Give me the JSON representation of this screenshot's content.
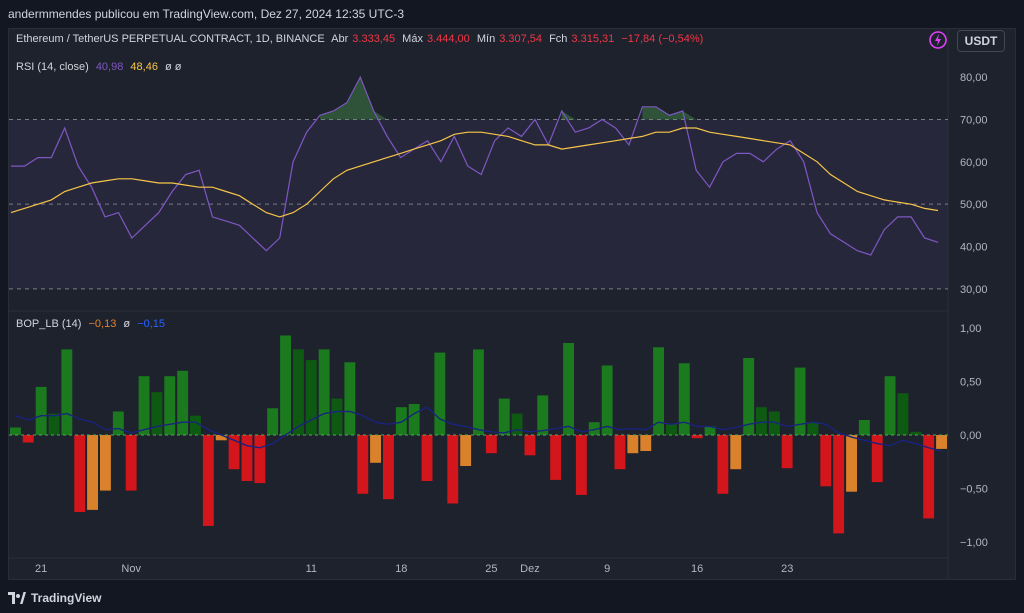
{
  "header": {
    "publisher_line": "andermmendes publicou em TradingView.com, Dez 27, 2024 12:35 UTC-3"
  },
  "symbol_legend": {
    "symbol": "Ethereum / TetherUS PERPETUAL CONTRACT, 1D, BINANCE",
    "open_label": "Abr",
    "open_value": "3.333,45",
    "high_label": "Máx",
    "high_value": "3.444,00",
    "low_label": "Mín",
    "low_value": "3.307,54",
    "close_label": "Fch",
    "close_value": "3.315,31",
    "change_value": "−17,84 (−0,54%)"
  },
  "rsi_legend": {
    "name": "RSI (14, close)",
    "rsi_value": "40,98",
    "ma_value": "48,46",
    "extra": "ø  ø"
  },
  "bop_legend": {
    "name": "BOP_LB (14)",
    "bop_value": "−0,13",
    "extra": "ø",
    "signal_value": "−0,15"
  },
  "currency_button": "USDT",
  "footer": {
    "brand": "TradingView"
  },
  "colors": {
    "background": "#131722",
    "pane": "#1e222d",
    "rsi_line": "#7e57c2",
    "rsi_ma": "#f7c548",
    "bop_green_strong": "#1b7a1e",
    "bop_green_weak": "#0f5a12",
    "bop_red_strong": "#d3151c",
    "bop_orange": "#d9822b",
    "bop_signal": "#1a237e"
  },
  "x_axis": {
    "labels": [
      "21",
      "Nov",
      "11",
      "18",
      "25",
      "Dez",
      "9",
      "16",
      "23"
    ],
    "label_bar_index": [
      2,
      9,
      23,
      30,
      37,
      40,
      46,
      53,
      60
    ]
  },
  "chart_data": [
    {
      "type": "line",
      "name": "RSI",
      "ylim": [
        25,
        85
      ],
      "yticks": [
        "80,00",
        "70,00",
        "60,00",
        "50,00",
        "40,00",
        "30,00"
      ],
      "ytick_values": [
        80,
        70,
        60,
        50,
        40,
        30
      ],
      "bands": {
        "upper": 70,
        "middle": 50,
        "lower": 30
      },
      "series": [
        {
          "name": "RSI (14, close)",
          "values": [
            59,
            59,
            61,
            61,
            68,
            59,
            54,
            47,
            48,
            42,
            45,
            48,
            53,
            57,
            58,
            47,
            46,
            45,
            42,
            39,
            42,
            60,
            67,
            71,
            72,
            74,
            80,
            72,
            66,
            61,
            63,
            65,
            60,
            66,
            59,
            57,
            65,
            68,
            66,
            70,
            64,
            72,
            67,
            68,
            70,
            68,
            64,
            73,
            73,
            71,
            72,
            58,
            54,
            60,
            62,
            62,
            60,
            63,
            65,
            60,
            48,
            43,
            41,
            39,
            38,
            44,
            47,
            47,
            42,
            41
          ]
        },
        {
          "name": "RSI MA",
          "values": [
            48,
            49,
            50,
            51,
            53,
            54,
            55,
            55.5,
            56,
            56,
            55.5,
            55,
            55,
            54.5,
            54,
            54,
            53,
            52,
            50,
            48,
            47,
            48,
            50,
            53,
            56,
            58,
            59,
            60,
            61,
            62,
            63,
            64,
            65,
            66.5,
            67,
            67,
            66.5,
            66,
            65,
            64,
            64,
            63,
            63.5,
            64,
            64.5,
            65,
            65.5,
            66,
            67,
            67,
            68,
            68,
            67,
            66.5,
            66,
            65.5,
            65,
            64.5,
            64,
            62,
            60,
            57,
            55,
            53,
            52,
            51,
            50.5,
            50,
            49,
            48.5
          ]
        }
      ]
    },
    {
      "type": "bar",
      "name": "BOP_LB",
      "ylim": [
        -1.15,
        1.15
      ],
      "yticks": [
        "1,00",
        "0,50",
        "0,00",
        "−0,50",
        "−1,00"
      ],
      "ytick_values": [
        1,
        0.5,
        0,
        -0.5,
        -1
      ],
      "series": [
        {
          "name": "BOP",
          "values": [
            0.07,
            -0.07,
            0.45,
            0.2,
            0.8,
            -0.72,
            -0.7,
            -0.52,
            0.22,
            -0.52,
            0.55,
            0.4,
            0.55,
            0.6,
            0.18,
            -0.85,
            -0.05,
            -0.32,
            -0.43,
            -0.45,
            0.25,
            0.93,
            0.8,
            0.7,
            0.8,
            0.34,
            0.68,
            -0.55,
            -0.26,
            -0.6,
            0.26,
            0.29,
            -0.43,
            0.77,
            -0.64,
            -0.29,
            0.8,
            -0.17,
            0.34,
            0.2,
            -0.19,
            0.37,
            -0.42,
            0.86,
            -0.56,
            0.12,
            0.65,
            -0.32,
            -0.17,
            -0.15,
            0.82,
            0.1,
            0.67,
            -0.03,
            0.08,
            -0.55,
            -0.32,
            0.72,
            0.26,
            0.22,
            -0.31,
            0.63,
            0.12,
            -0.48,
            -0.92,
            -0.53,
            0.14,
            -0.44,
            0.55,
            0.39,
            0.03,
            -0.78,
            -0.13
          ]
        },
        {
          "name": "Signal",
          "values": [
            0.18,
            0.14,
            0.18,
            0.18,
            0.2,
            0.15,
            0.12,
            0.05,
            0.06,
            0.02,
            0.05,
            0.08,
            0.1,
            0.12,
            0.12,
            0.05,
            0.0,
            -0.05,
            -0.1,
            -0.12,
            -0.08,
            0.0,
            0.08,
            0.14,
            0.2,
            0.22,
            0.22,
            0.18,
            0.12,
            0.1,
            0.12,
            0.2,
            0.26,
            0.15,
            0.1,
            0.08,
            0.05,
            0.03,
            0.02,
            0.05,
            0.03,
            0.04,
            0.06,
            0.08,
            0.03,
            0.05,
            0.08,
            0.05,
            0.06,
            0.05,
            0.12,
            0.1,
            0.12,
            0.08,
            0.08,
            0.05,
            0.07,
            0.1,
            0.12,
            0.12,
            0.08,
            0.1,
            0.12,
            0.1,
            0.02,
            -0.02,
            -0.05,
            -0.08,
            -0.1,
            -0.05,
            -0.08,
            -0.12,
            -0.15
          ]
        }
      ]
    }
  ]
}
